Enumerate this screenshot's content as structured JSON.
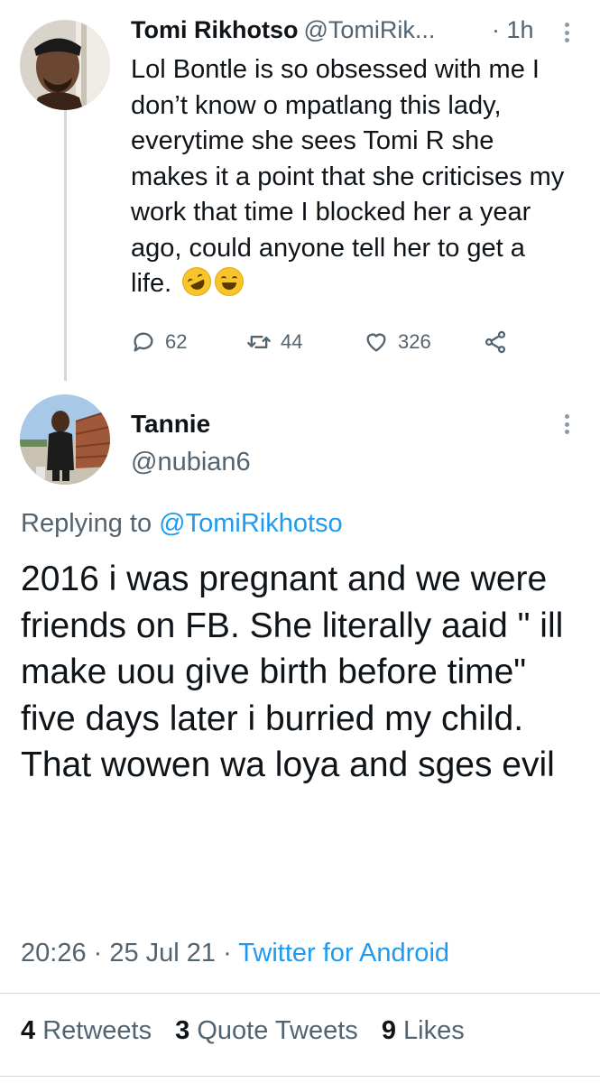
{
  "parent_tweet": {
    "author_name": "Tomi Rikhotso",
    "author_handle": "@TomiRik...",
    "time": "· 1h",
    "text": "Lol Bontle is so obsessed with me I don’t know o mpatlang this lady, everytime she sees Tomi R she makes it a point that she criticises my work that time I blocked her a year ago, could anyone tell her to get a life.",
    "emojis": [
      "rolling-on-floor-laughing",
      "face-with-tears-of-joy"
    ],
    "reply_count": "62",
    "retweet_count": "44",
    "like_count": "326"
  },
  "reply_tweet": {
    "author_name": "Tannie",
    "author_handle": "@nubian6",
    "replying_prefix": "Replying to",
    "replying_to": "@TomiRikhotso",
    "text": "2016 i was pregnant and we were friends on FB. She literally aaid \" ill make uou give birth before time\" five days later i burried my child. That wowen wa loya and sges evil",
    "timestamp": "20:26 · 25 Jul 21",
    "separator": " · ",
    "source": "Twitter for Android"
  },
  "stats": {
    "retweets_count": "4",
    "retweets_label": "Retweets",
    "quote_count": "3",
    "quote_label": "Quote Tweets",
    "likes_count": "9",
    "likes_label": "Likes"
  },
  "colors": {
    "text": "#0f1419",
    "secondary": "#536471",
    "link": "#1d9bf0",
    "divider": "#cfd9de"
  }
}
